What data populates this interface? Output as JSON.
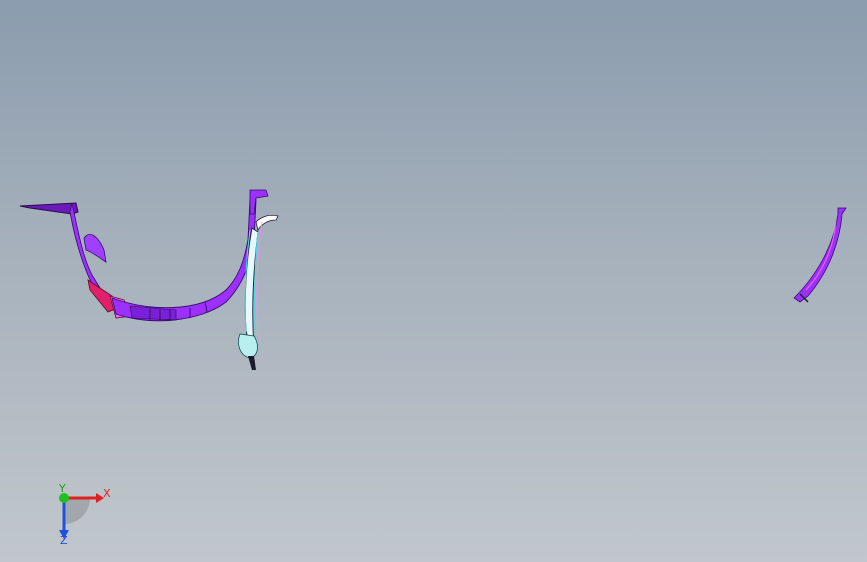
{
  "viewport": {
    "background_top": "#8b9cae",
    "background_bottom": "#c1c7cc"
  },
  "model": {
    "part_color": "#9b30ff",
    "part_dark": "#6a1ab8",
    "highlight_color": "#ff66e0",
    "accent_red": "#e0206a",
    "accent_cyan": "#40e0e8"
  },
  "triad": {
    "x_label": "X",
    "y_label": "Y",
    "z_label": "Z",
    "x_color": "#e02020",
    "y_color": "#20c020",
    "z_color": "#2050e0"
  }
}
